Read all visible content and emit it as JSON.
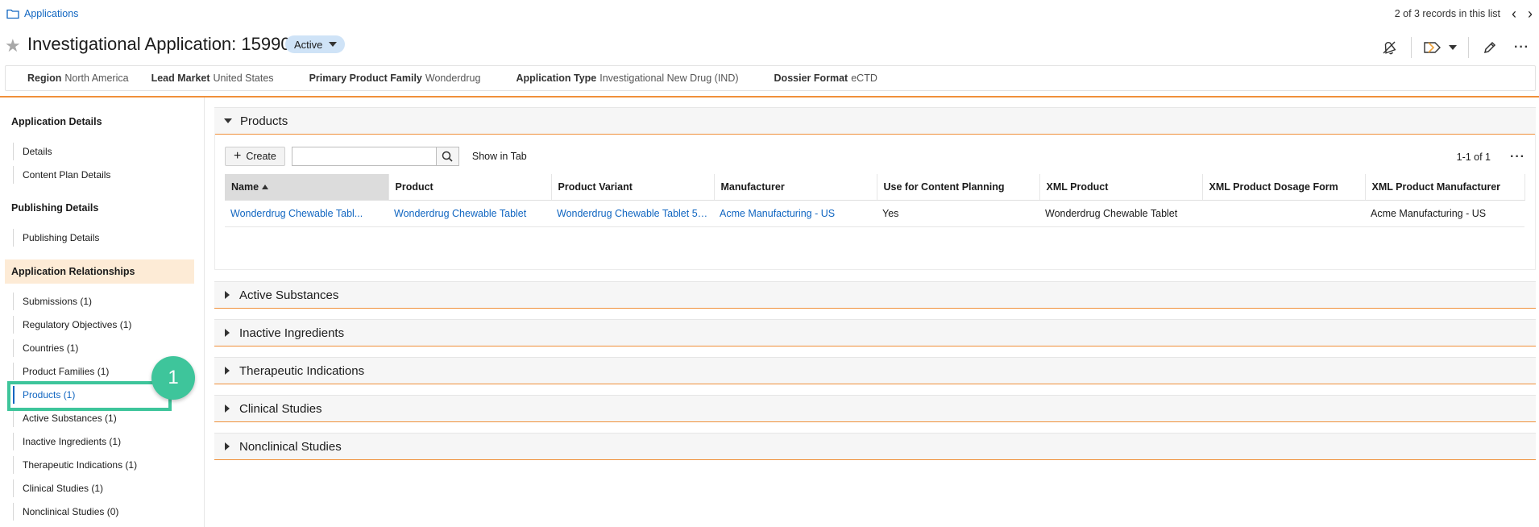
{
  "breadcrumb": {
    "label": "Applications",
    "icon": "folder-icon"
  },
  "records": {
    "text": "2 of 3 records in this list"
  },
  "header": {
    "title": "Investigational Application: 159901",
    "status": "Active"
  },
  "fields": [
    {
      "label": "Region",
      "value": "North America"
    },
    {
      "label": "Lead Market",
      "value": "United States"
    },
    {
      "label": "Primary Product Family",
      "value": "Wonderdrug"
    },
    {
      "label": "Application Type",
      "value": "Investigational New Drug (IND)"
    },
    {
      "label": "Dossier Format",
      "value": "eCTD"
    }
  ],
  "sidebar": {
    "application_details": "Application Details",
    "details": "Details",
    "content_plan_details": "Content Plan Details",
    "publishing_details_head": "Publishing Details",
    "publishing_details": "Publishing Details",
    "application_relationships": "Application Relationships",
    "items": [
      "Submissions (1)",
      "Regulatory Objectives (1)",
      "Countries (1)",
      "Product Families (1)",
      "Products (1)",
      "Active Substances (1)",
      "Inactive Ingredients (1)",
      "Therapeutic Indications (1)",
      "Clinical Studies (1)",
      "Nonclinical Studies (0)"
    ]
  },
  "callout": {
    "number": "1"
  },
  "products_panel": {
    "title": "Products",
    "create_label": "Create",
    "search_placeholder": "",
    "show_in_tab": "Show in Tab",
    "pager": "1-1 of 1",
    "columns": [
      "Name",
      "Product",
      "Product Variant",
      "Manufacturer",
      "Use for Content Planning",
      "XML Product",
      "XML Product Dosage Form",
      "XML Product Manufacturer"
    ],
    "rows": [
      {
        "name": "Wonderdrug Chewable Tabl...",
        "product": "Wonderdrug Chewable Tablet",
        "variant": "Wonderdrug Chewable Tablet 50...",
        "manufacturer": "Acme Manufacturing - US",
        "use_for_content_planning": "Yes",
        "xml_product": "Wonderdrug Chewable Tablet",
        "xml_dosage_form": "",
        "xml_manufacturer": "Acme Manufacturing - US"
      }
    ]
  },
  "collapsed_panels": [
    "Active Substances",
    "Inactive Ingredients",
    "Therapeutic Indications",
    "Clinical Studies",
    "Nonclinical Studies"
  ],
  "colors": {
    "accent_orange": "#f0903a",
    "link_blue": "#1166c1",
    "highlight_green": "#3ec59b",
    "status_pill": "#cfe3f7",
    "active_section": "#fdebd6"
  }
}
